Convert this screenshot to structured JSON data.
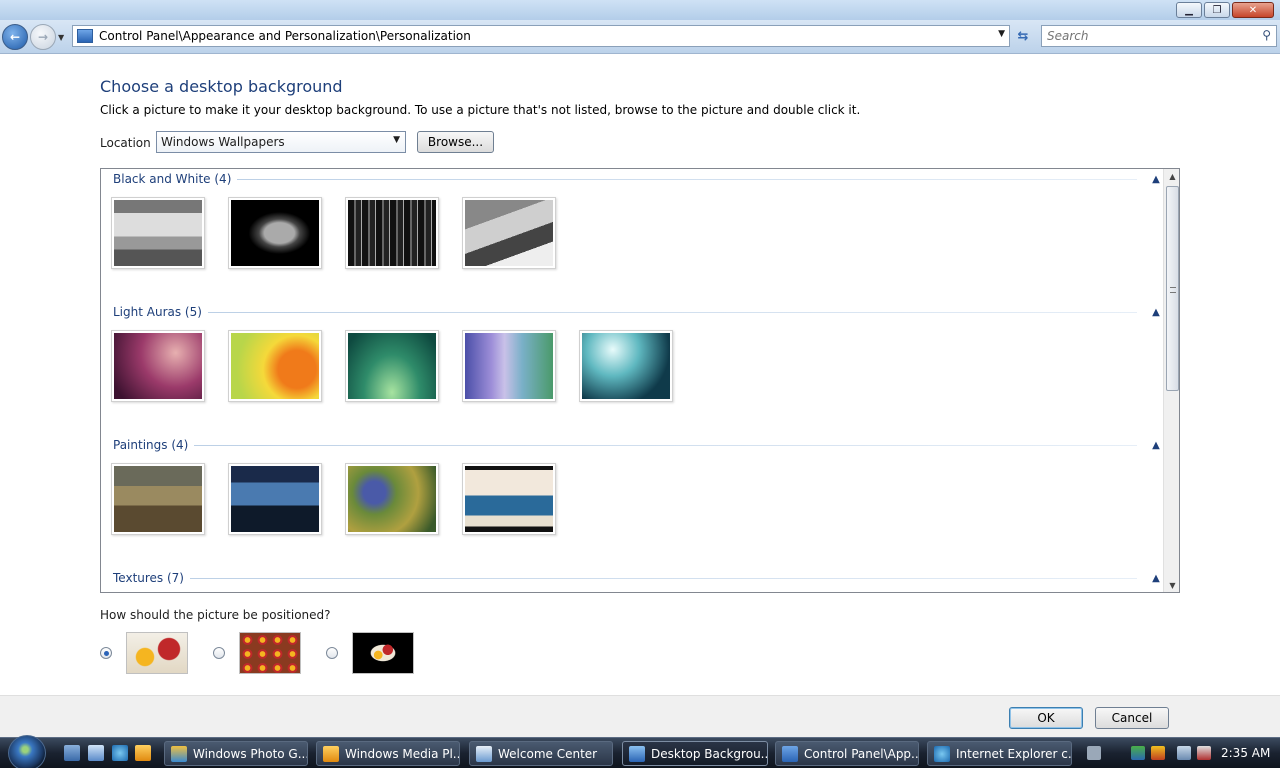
{
  "window": {
    "min_label": "▁",
    "max_label": "❐",
    "close_label": "✕"
  },
  "addressbar": {
    "path": "Control Panel\\Appearance and Personalization\\Personalization",
    "search_placeholder": "Search"
  },
  "page": {
    "heading": "Choose a desktop background",
    "instruction": "Click a picture to make it your desktop background. To use a picture that's not listed, browse to the picture and double click it.",
    "location_label": "Location",
    "location_value": "Windows Wallpapers",
    "browse_label": "Browse...",
    "groups": [
      {
        "label": "Black and White (4)"
      },
      {
        "label": "Light Auras (5)"
      },
      {
        "label": "Paintings (4)"
      },
      {
        "label": "Textures (7)"
      }
    ],
    "position_question": "How should the picture be positioned?",
    "position_options": [
      {
        "name": "fit-to-screen",
        "selected": true
      },
      {
        "name": "tile",
        "selected": false
      },
      {
        "name": "center",
        "selected": false
      }
    ],
    "ok_label": "OK",
    "cancel_label": "Cancel"
  },
  "taskbar": {
    "tasks": [
      {
        "label": "Windows Photo G..."
      },
      {
        "label": "Windows Media Pl..."
      },
      {
        "label": "Welcome Center"
      },
      {
        "label": "Desktop Backgrou...",
        "active": true
      },
      {
        "label": "Control Panel\\App..."
      },
      {
        "label": "Internet Explorer c..."
      }
    ],
    "clock": "2:35 AM"
  },
  "colors": {
    "heading": "#1e3f7a",
    "group_label": "#1e3f7a",
    "taskbar": "#1a2230"
  }
}
